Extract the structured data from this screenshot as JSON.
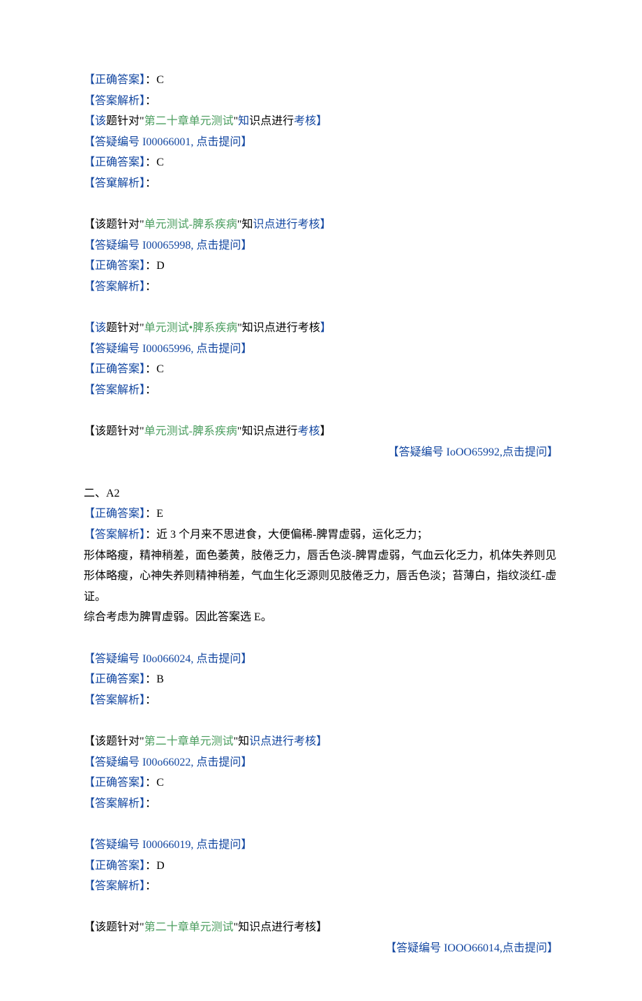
{
  "lbr": "【",
  "rbr": "】",
  "lq": "\"",
  "rq": "\"",
  "labels": {
    "correct": "正确答案",
    "analysis": "答案解析",
    "analysis2": "答窠解析",
    "clickAsk": "点击提问",
    "faqPrefix": "答疑编号",
    "topicPrefix": "该",
    "topicMid1": "题针对",
    "topicMid2": "知",
    "topicMid3": "识点进行",
    "topicTail": "考核"
  },
  "sectionA": {
    "items": [
      {
        "answer": "C",
        "faq": "I00066001",
        "topic": "第二十章单元测试",
        "topicBlue": true,
        "analysisLabel": "答案解析"
      },
      {
        "answer": "C",
        "faq": "I00065998",
        "topic": "单元测试-脾系疾病",
        "topicBlue": false,
        "analysisLabel": "答窠解析"
      },
      {
        "answer": "D",
        "faq": "I00065996",
        "topic": "单元测试•脾系疾病",
        "topicBlue": true,
        "analysisLabel": "答案解析"
      },
      {
        "answer": "C",
        "faq": null,
        "topic": "单元测试-脾系疾病",
        "topicBlue": false,
        "analysisLabel": "答案解析"
      }
    ],
    "rightFaq": "IoOO65992"
  },
  "sectionB": {
    "heading": "二、A2",
    "firstAnswer": "E",
    "analysisIntro": "：近 3 个月来不思进食，大便偏稀-脾胃虚弱，运化乏力；",
    "body1": "形体略瘦，精神稍差，面色萎黄，肢倦乏力，唇舌色淡-脾胃虚弱，气血云化乏力，机体失养则见形体略瘦，心神失养则精神稍差，气血生化乏源则见肢倦乏力，唇舌色淡；苔薄白，指纹淡红-虚证。",
    "body2": "综合考虑为脾胃虚弱。因此答案选 E。",
    "items": [
      {
        "faq": "I0o066024",
        "answer": "B",
        "topic": "第二十章单元测试",
        "nextFaq": "I00o66022"
      },
      {
        "faq": null,
        "answer": "C",
        "topic": null,
        "nextFaq": "I00066019"
      },
      {
        "faq": null,
        "answer": "D",
        "topic": "第二十章单元测试",
        "nextFaq": null
      }
    ],
    "rightFaq": "IOOO66014"
  }
}
